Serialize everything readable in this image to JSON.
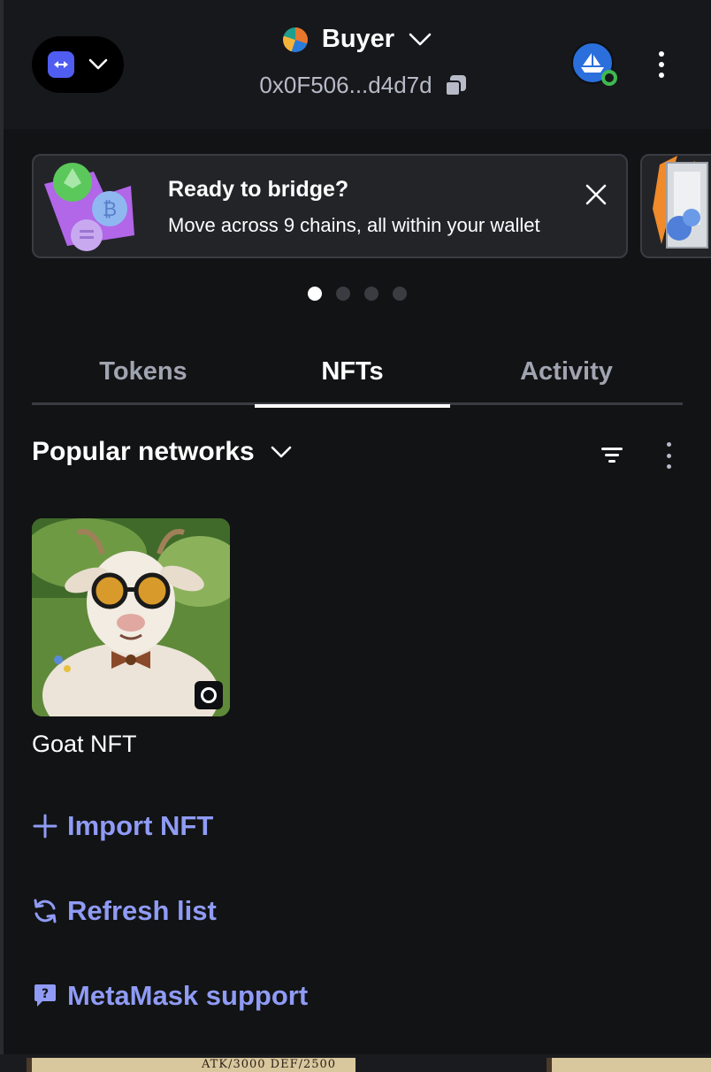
{
  "header": {
    "network_menu_icon": "chevron-down-icon",
    "account_name": "Buyer",
    "account_address": "0x0F506...d4d7d"
  },
  "banner": {
    "title": "Ready to bridge?",
    "text": "Move across 9 chains, all within your wallet",
    "active_slide": 1,
    "slide_count": 4
  },
  "tabs": [
    {
      "label": "Tokens",
      "active": false
    },
    {
      "label": "NFTs",
      "active": true
    },
    {
      "label": "Activity",
      "active": false
    }
  ],
  "filters": {
    "network_label": "Popular networks"
  },
  "nfts": [
    {
      "name": "Goat NFT"
    }
  ],
  "actions": {
    "import": "Import NFT",
    "refresh": "Refresh list",
    "support": "MetaMask support"
  },
  "background_card": {
    "stats": "ATK/3000  DEF/2500"
  },
  "colors": {
    "background": "#121314",
    "header": "#17181b",
    "accent_link": "#8f9bf5",
    "tab_inactive": "#a0a4b0",
    "status_connected": "#3fb950"
  }
}
